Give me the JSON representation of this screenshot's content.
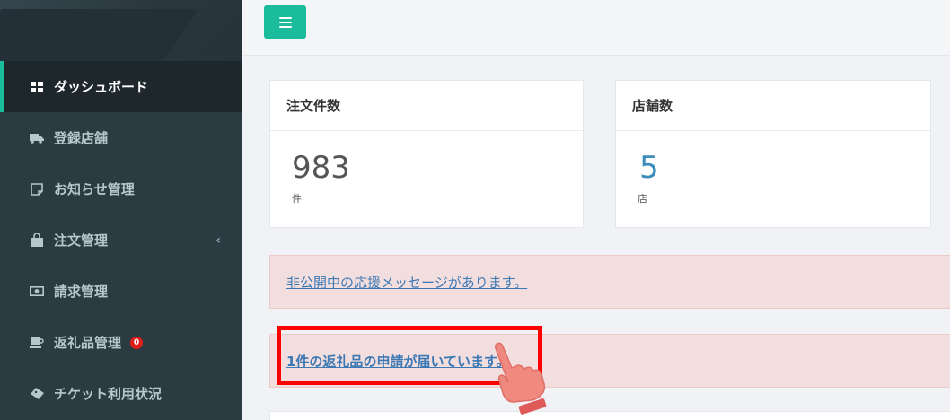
{
  "sidebar": {
    "items": [
      {
        "label": "ダッシュボード",
        "icon": "dashboard-icon",
        "active": true
      },
      {
        "label": "登録店舗",
        "icon": "truck-icon"
      },
      {
        "label": "お知らせ管理",
        "icon": "note-icon"
      },
      {
        "label": "注文管理",
        "icon": "shopping-bag-icon",
        "has_submenu": true
      },
      {
        "label": "請求管理",
        "icon": "money-icon"
      },
      {
        "label": "返礼品管理",
        "icon": "coffee-icon",
        "badge": "0"
      },
      {
        "label": "チケット利用状況",
        "icon": "ticket-icon"
      }
    ]
  },
  "topbar": {
    "menu_toggle_icon": "hamburger-icon"
  },
  "cards": [
    {
      "title": "注文件数",
      "value": "983",
      "unit": "件"
    },
    {
      "title": "店舗数",
      "value": "5",
      "unit": "店"
    }
  ],
  "alerts": {
    "support_message": "非公開中の応援メッセージがあります。",
    "gift_request": "1件の返礼品の申請が届いています。"
  },
  "colors": {
    "sidebar_bg": "#2c3b41",
    "accent": "#1abc9c",
    "alert_bg": "#f2dede",
    "link": "#3c78b4",
    "highlight": "#ff0000"
  }
}
